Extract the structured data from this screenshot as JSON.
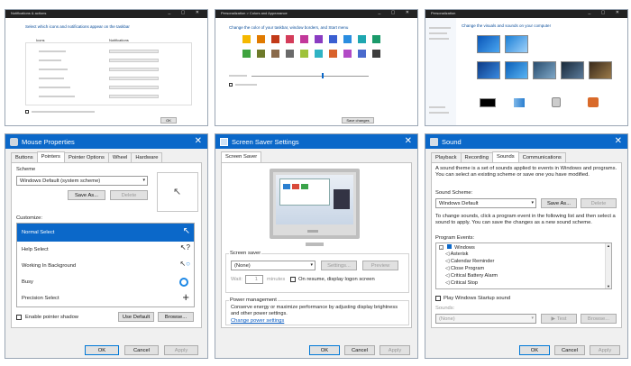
{
  "top_panels": {
    "left": {
      "title": "Notifications & actions",
      "heading": "Select which icons and notifications appear on the taskbar",
      "col1": "Icons",
      "col2": "Notifications",
      "button": "OK"
    },
    "middle": {
      "title": "Personalization > Colors and Appearance",
      "heading": "Change the color of your taskbar, window borders, and Start menu",
      "button": "Save changes"
    },
    "right": {
      "title": "Personalization",
      "heading": "Change the visuals and sounds on your computer",
      "button": "OK"
    }
  },
  "mouse": {
    "title": "Mouse Properties",
    "tabs": [
      "Buttons",
      "Pointers",
      "Pointer Options",
      "Wheel",
      "Hardware"
    ],
    "scheme_label": "Scheme",
    "scheme_value": "Windows Default (system scheme)",
    "save_as": "Save As...",
    "delete": "Delete",
    "customize_label": "Customize:",
    "items": [
      "Normal Select",
      "Help Select",
      "Working In Background",
      "Busy",
      "Precision Select"
    ],
    "enable_shadow": "Enable pointer shadow",
    "use_default": "Use Default",
    "browse": "Browse...",
    "ok": "OK",
    "cancel": "Cancel",
    "apply": "Apply"
  },
  "saver": {
    "title": "Screen Saver Settings",
    "tab": "Screen Saver",
    "saver_label": "Screen saver",
    "saver_value": "(None)",
    "settings": "Settings...",
    "preview": "Preview",
    "wait": "Wait:",
    "wait_value": "1",
    "minutes": "minutes",
    "resume": "On resume, display logon screen",
    "power_group": "Power management",
    "power_text": "Conserve energy or maximize performance by adjusting display brightness and other power settings.",
    "power_link": "Change power settings",
    "ok": "OK",
    "cancel": "Cancel",
    "apply": "Apply"
  },
  "sound": {
    "title": "Sound",
    "tabs": [
      "Playback",
      "Recording",
      "Sounds",
      "Communications"
    ],
    "desc": "A sound theme is a set of sounds applied to events in Windows and programs. You can select an existing scheme or save one you have modified.",
    "scheme_label": "Sound Scheme:",
    "scheme_value": "Windows Default",
    "save_as": "Save As...",
    "delete": "Delete",
    "change_desc": "To change sounds, click a program event in the following list and then select a sound to apply. You can save the changes as a new sound scheme.",
    "events_label": "Program Events:",
    "root": "Windows",
    "events": [
      "Asterisk",
      "Calendar Reminder",
      "Close Program",
      "Critical Battery Alarm",
      "Critical Stop"
    ],
    "startup": "Play Windows Startup sound",
    "sounds_label": "Sounds:",
    "sounds_value": "(None)",
    "test": "Test",
    "browse": "Browse...",
    "ok": "OK",
    "cancel": "Cancel",
    "apply": "Apply"
  },
  "colors": {
    "accent": "#0b68c9",
    "selected_row": "#0b68c9",
    "swatches": [
      "#f5b800",
      "#e07a00",
      "#c23a18",
      "#d43c5a",
      "#c2389a",
      "#8a3cc2",
      "#3a5fd1",
      "#2a8de0",
      "#1fa7b0",
      "#1a9a6a",
      "#3fa33f",
      "#6e7a2a",
      "#8a6a4a",
      "#6a6a6a",
      "#9ec23a",
      "#2fb3c4",
      "#d9622b",
      "#b24ac6",
      "#4a6acd",
      "#3e3e3e"
    ]
  }
}
